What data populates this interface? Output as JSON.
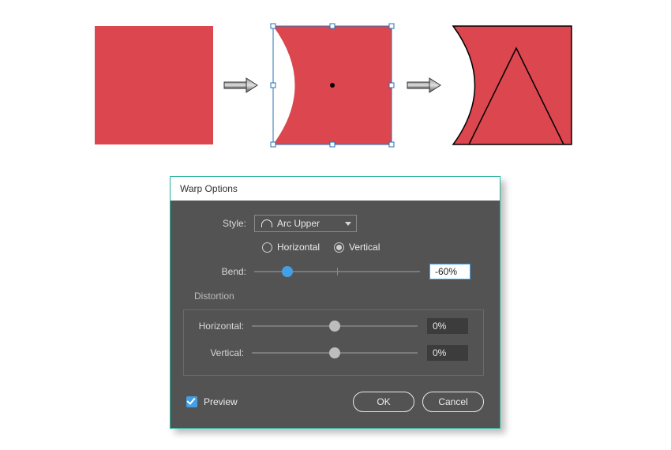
{
  "illustration": {
    "color": "#db464f"
  },
  "dialog": {
    "title": "Warp Options",
    "style_label": "Style:",
    "style_value": "Arc Upper",
    "orientation": {
      "horizontal": "Horizontal",
      "vertical": "Vertical",
      "selected": "vertical"
    },
    "bend": {
      "label": "Bend:",
      "value": "-60%",
      "pos": 20
    },
    "distortion": {
      "group_label": "Distortion",
      "horizontal": {
        "label": "Horizontal:",
        "value": "0%",
        "pos": 50
      },
      "vertical": {
        "label": "Vertical:",
        "value": "0%",
        "pos": 50
      }
    },
    "preview_label": "Preview",
    "ok": "OK",
    "cancel": "Cancel"
  }
}
